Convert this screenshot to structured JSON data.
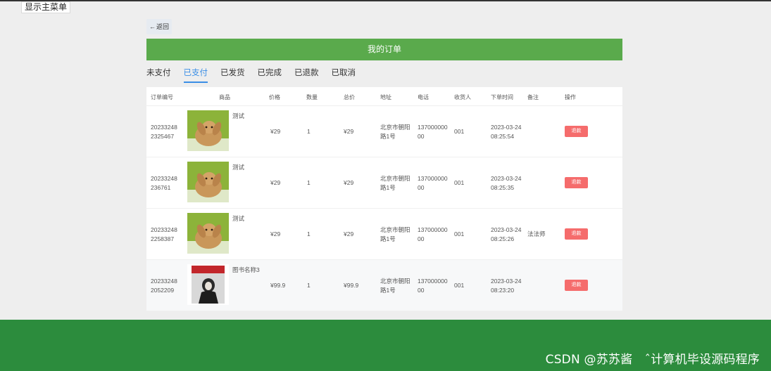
{
  "topbar": {
    "show_menu_label": "显示主菜单"
  },
  "nav": {
    "back_label": "返回",
    "back_arrow": "←"
  },
  "page": {
    "title": "我的订单"
  },
  "tabs": [
    {
      "label": "未支付"
    },
    {
      "label": "已支付"
    },
    {
      "label": "已发货"
    },
    {
      "label": "已完成"
    },
    {
      "label": "已退款"
    },
    {
      "label": "已取消"
    }
  ],
  "active_tab": "已支付",
  "columns": {
    "order_no": "订单编号",
    "product": "商品",
    "price": "价格",
    "quantity": "数量",
    "total": "总价",
    "address": "地址",
    "phone": "电话",
    "receiver": "收货人",
    "order_time": "下单时间",
    "remark": "备注",
    "action": "操作"
  },
  "orders": [
    {
      "order_no": "202332482325467",
      "product_name": "测试",
      "product_image": "rabbit-photo",
      "price": "¥29",
      "quantity": "1",
      "total": "¥29",
      "address": "北京市朝阳路1号",
      "phone": "13700000000",
      "receiver": "001",
      "order_time": "2023-03-24 08:25:54",
      "remark": "",
      "action_label": "退款"
    },
    {
      "order_no": "20233248236761",
      "product_name": "测试",
      "product_image": "rabbit-photo",
      "price": "¥29",
      "quantity": "1",
      "total": "¥29",
      "address": "北京市朝阳路1号",
      "phone": "13700000000",
      "receiver": "001",
      "order_time": "2023-03-24 08:25:35",
      "remark": "",
      "action_label": "退款"
    },
    {
      "order_no": "202332482258387",
      "product_name": "测试",
      "product_image": "rabbit-photo",
      "price": "¥29",
      "quantity": "1",
      "total": "¥29",
      "address": "北京市朝阳路1号",
      "phone": "13700000000",
      "receiver": "001",
      "order_time": "2023-03-24 08:25:26",
      "remark": "法法师",
      "action_label": "退款"
    },
    {
      "order_no": "202332482052209",
      "product_name": "图书名称3",
      "product_image": "magazine-cover",
      "price": "¥99.9",
      "quantity": "1",
      "total": "¥99.9",
      "address": "北京市朝阳路1号",
      "phone": "13700000000",
      "receiver": "001",
      "order_time": "2023-03-24 08:23:20",
      "remark": "",
      "action_label": "退款"
    }
  ],
  "watermark": "CSDN @苏苏酱　ˆ计算机毕设源码程序",
  "colors": {
    "title_bar": "#5aaa4c",
    "footer": "#2c8c3d",
    "active_tab": "#3a8ee6",
    "refund_button": "#f56c6c",
    "page_bg": "#eeeeee"
  }
}
